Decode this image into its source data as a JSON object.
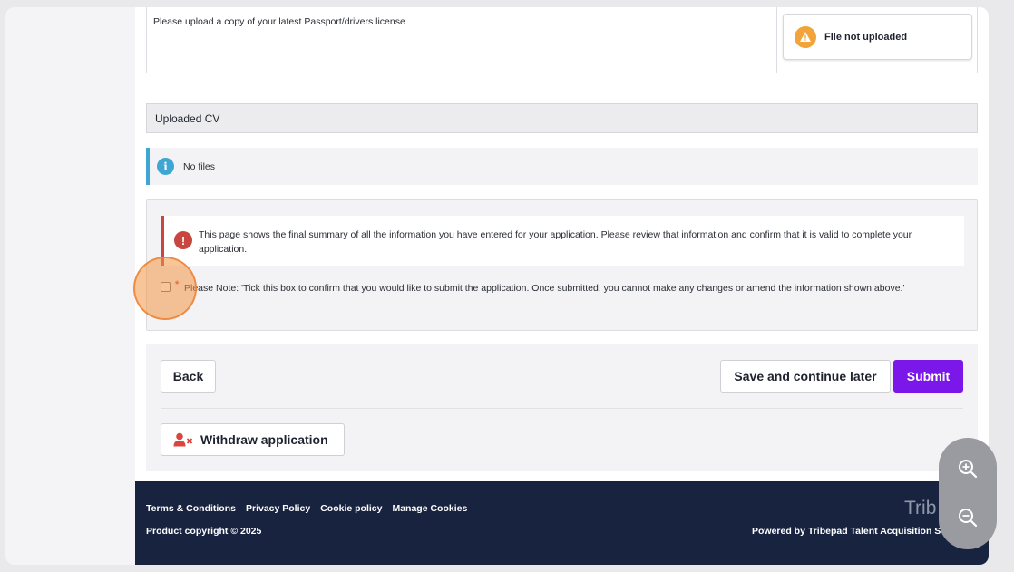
{
  "documents": {
    "passport_label": "Please upload a copy of your latest Passport/drivers license",
    "status": {
      "label": "File not uploaded",
      "color": "#f2a43a",
      "icon": "warning-triangle-icon"
    }
  },
  "cv_section": {
    "title": "Uploaded CV",
    "info_icon": "info-icon",
    "info_text": "No files"
  },
  "confirmation": {
    "alert_icon": "exclamation-icon",
    "alert_color": "#c9453f",
    "alert_text": "This page shows the final summary of all the information you have entered for your application. Please review that information and confirm that it is valid to complete your application.",
    "required_marker": "*",
    "checkbox_checked": false,
    "checkbox_label": "Please Note: 'Tick this box to confirm that you would like to submit the application. Once submitted, you cannot make any changes or amend the information shown above.'"
  },
  "actions": {
    "back_label": "Back",
    "save_label": "Save and continue later",
    "submit_label": "Submit",
    "submit_color": "#7b17e8",
    "withdraw_label": "Withdraw application",
    "withdraw_icon": "user-remove-icon"
  },
  "footer": {
    "links": [
      "Terms & Conditions",
      "Privacy Policy",
      "Cookie policy",
      "Manage Cookies"
    ],
    "copyright": "Product copyright © 2025",
    "brand": "Trib",
    "powered_by": "Powered by Tribepad Talent Acquisition S"
  },
  "zoom": {
    "zoom_in_icon": "zoom-in-icon",
    "zoom_out_icon": "zoom-out-icon"
  }
}
